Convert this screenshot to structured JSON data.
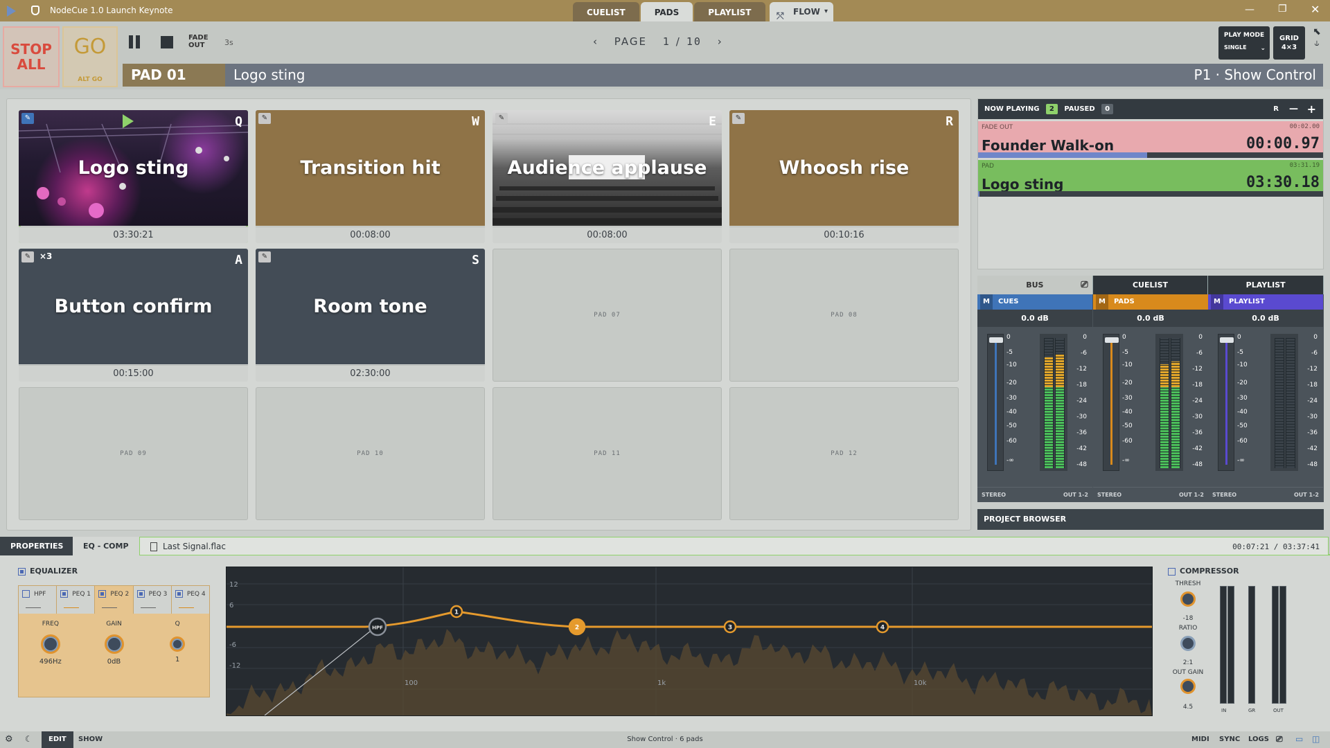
{
  "window": {
    "title": "NodeCue 1.0 Launch Keynote"
  },
  "top_tabs": [
    {
      "label": "CUELIST"
    },
    {
      "label": "PADS"
    },
    {
      "label": "PLAYLIST"
    }
  ],
  "flow": {
    "label": "FLOW"
  },
  "toolbar": {
    "stop_all": "STOP ALL",
    "go": "GO",
    "alt_go": "ALT GO",
    "fade_out": "FADE OUT",
    "fade_seconds": "3s",
    "page_label": "PAGE",
    "page_current": "1",
    "page_sep": "/",
    "page_total": "10",
    "play_mode_label": "PLAY MODE",
    "play_mode_value": "SINGLE",
    "grid_label": "GRID",
    "grid_value": "4×3"
  },
  "selected": {
    "pad": "PAD 01",
    "name": "Logo sting",
    "context": "P1 · Show Control"
  },
  "pads": [
    {
      "title": "Logo sting",
      "key": "Q",
      "duration": "03:30:21",
      "loop": ""
    },
    {
      "title": "Transition hit",
      "key": "W",
      "duration": "00:08:00",
      "loop": ""
    },
    {
      "title": "Audience applause",
      "key": "E",
      "duration": "00:08:00",
      "loop": ""
    },
    {
      "title": "Whoosh rise",
      "key": "R",
      "duration": "00:10:16",
      "loop": ""
    },
    {
      "title": "Button confirm",
      "key": "A",
      "duration": "00:15:00",
      "loop": "×3"
    },
    {
      "title": "Room tone",
      "key": "S",
      "duration": "02:30:00",
      "loop": ""
    },
    {
      "label": "PAD 07"
    },
    {
      "label": "PAD 08"
    },
    {
      "label": "PAD 09"
    },
    {
      "label": "PAD 10"
    },
    {
      "label": "PAD 11"
    },
    {
      "label": "PAD 12"
    }
  ],
  "now_playing": {
    "title": "NOW PLAYING",
    "playing_count": "2",
    "paused_label": "PAUSED",
    "paused_count": "0",
    "r_label": "R",
    "items": [
      {
        "tag": "FADE OUT",
        "elapsed": "00:02.00",
        "name": "Founder Walk-on",
        "time": "00:00.97",
        "progress": 0.49
      },
      {
        "tag": "PAD",
        "elapsed": "03:31.19",
        "name": "Logo sting",
        "time": "03:30.18",
        "progress": 0.005
      }
    ]
  },
  "mixer": {
    "tabs": [
      {
        "label": "BUS"
      },
      {
        "label": "CUELIST"
      },
      {
        "label": "PLAYLIST"
      }
    ],
    "fader_scale": [
      "0",
      "-5",
      "-10",
      "-20",
      "-30",
      "-40",
      "-50",
      "-60",
      "-∞"
    ],
    "meter_scale": [
      "0",
      "-6",
      "-12",
      "-18",
      "-24",
      "-30",
      "-36",
      "-42",
      "-48"
    ],
    "channels": [
      {
        "mute": "M",
        "name": "CUES",
        "db": "0.0 dB",
        "mode": "STEREO",
        "out": "OUT 1-2",
        "color": "#3f74b8",
        "level_l": 0.85,
        "level_r": 0.88
      },
      {
        "mute": "M",
        "name": "PADS",
        "db": "0.0 dB",
        "mode": "STEREO",
        "out": "OUT 1-2",
        "color": "#d88a1c",
        "level_l": 0.8,
        "level_r": 0.82
      },
      {
        "mute": "M",
        "name": "PLAYLIST",
        "db": "0.0 dB",
        "mode": "STEREO",
        "out": "OUT 1-2",
        "color": "#5a4ad0",
        "level_l": 0.0,
        "level_r": 0.0
      }
    ]
  },
  "project_browser": {
    "label": "PROJECT BROWSER"
  },
  "bottom_tabs": [
    {
      "label": "PROPERTIES"
    },
    {
      "label": "EQ - COMP"
    }
  ],
  "file": {
    "name": "Last Signal.flac",
    "time": "00:07:21 / 03:37:41"
  },
  "equalizer": {
    "label": "EQUALIZER",
    "bands": [
      {
        "label": "HPF"
      },
      {
        "label": "PEQ 1"
      },
      {
        "label": "PEQ 2"
      },
      {
        "label": "PEQ 3"
      },
      {
        "label": "PEQ 4"
      }
    ],
    "knobs": [
      {
        "label": "FREQ",
        "value": "496Hz"
      },
      {
        "label": "GAIN",
        "value": "0dB"
      },
      {
        "label": "Q",
        "value": "1"
      }
    ],
    "graph": {
      "y_ticks": [
        "12",
        "6",
        "-6",
        "-12"
      ],
      "x_ticks": [
        "100",
        "1k",
        "10k"
      ],
      "nodes": [
        "HPF",
        "1",
        "2",
        "3",
        "4"
      ]
    }
  },
  "compressor": {
    "label": "COMPRESSOR",
    "thresh_label": "THRESH",
    "thresh_value": "-18",
    "ratio_label": "RATIO",
    "ratio_value": "2:1",
    "outgain_label": "OUT GAIN",
    "outgain_value": "4.5",
    "meter_labels": [
      "IN",
      "GR",
      "OUT"
    ]
  },
  "status": {
    "edit": "EDIT",
    "show": "SHOW",
    "center": "Show Control · 6 pads",
    "right": [
      "MIDI",
      "SYNC",
      "LOGS"
    ]
  }
}
